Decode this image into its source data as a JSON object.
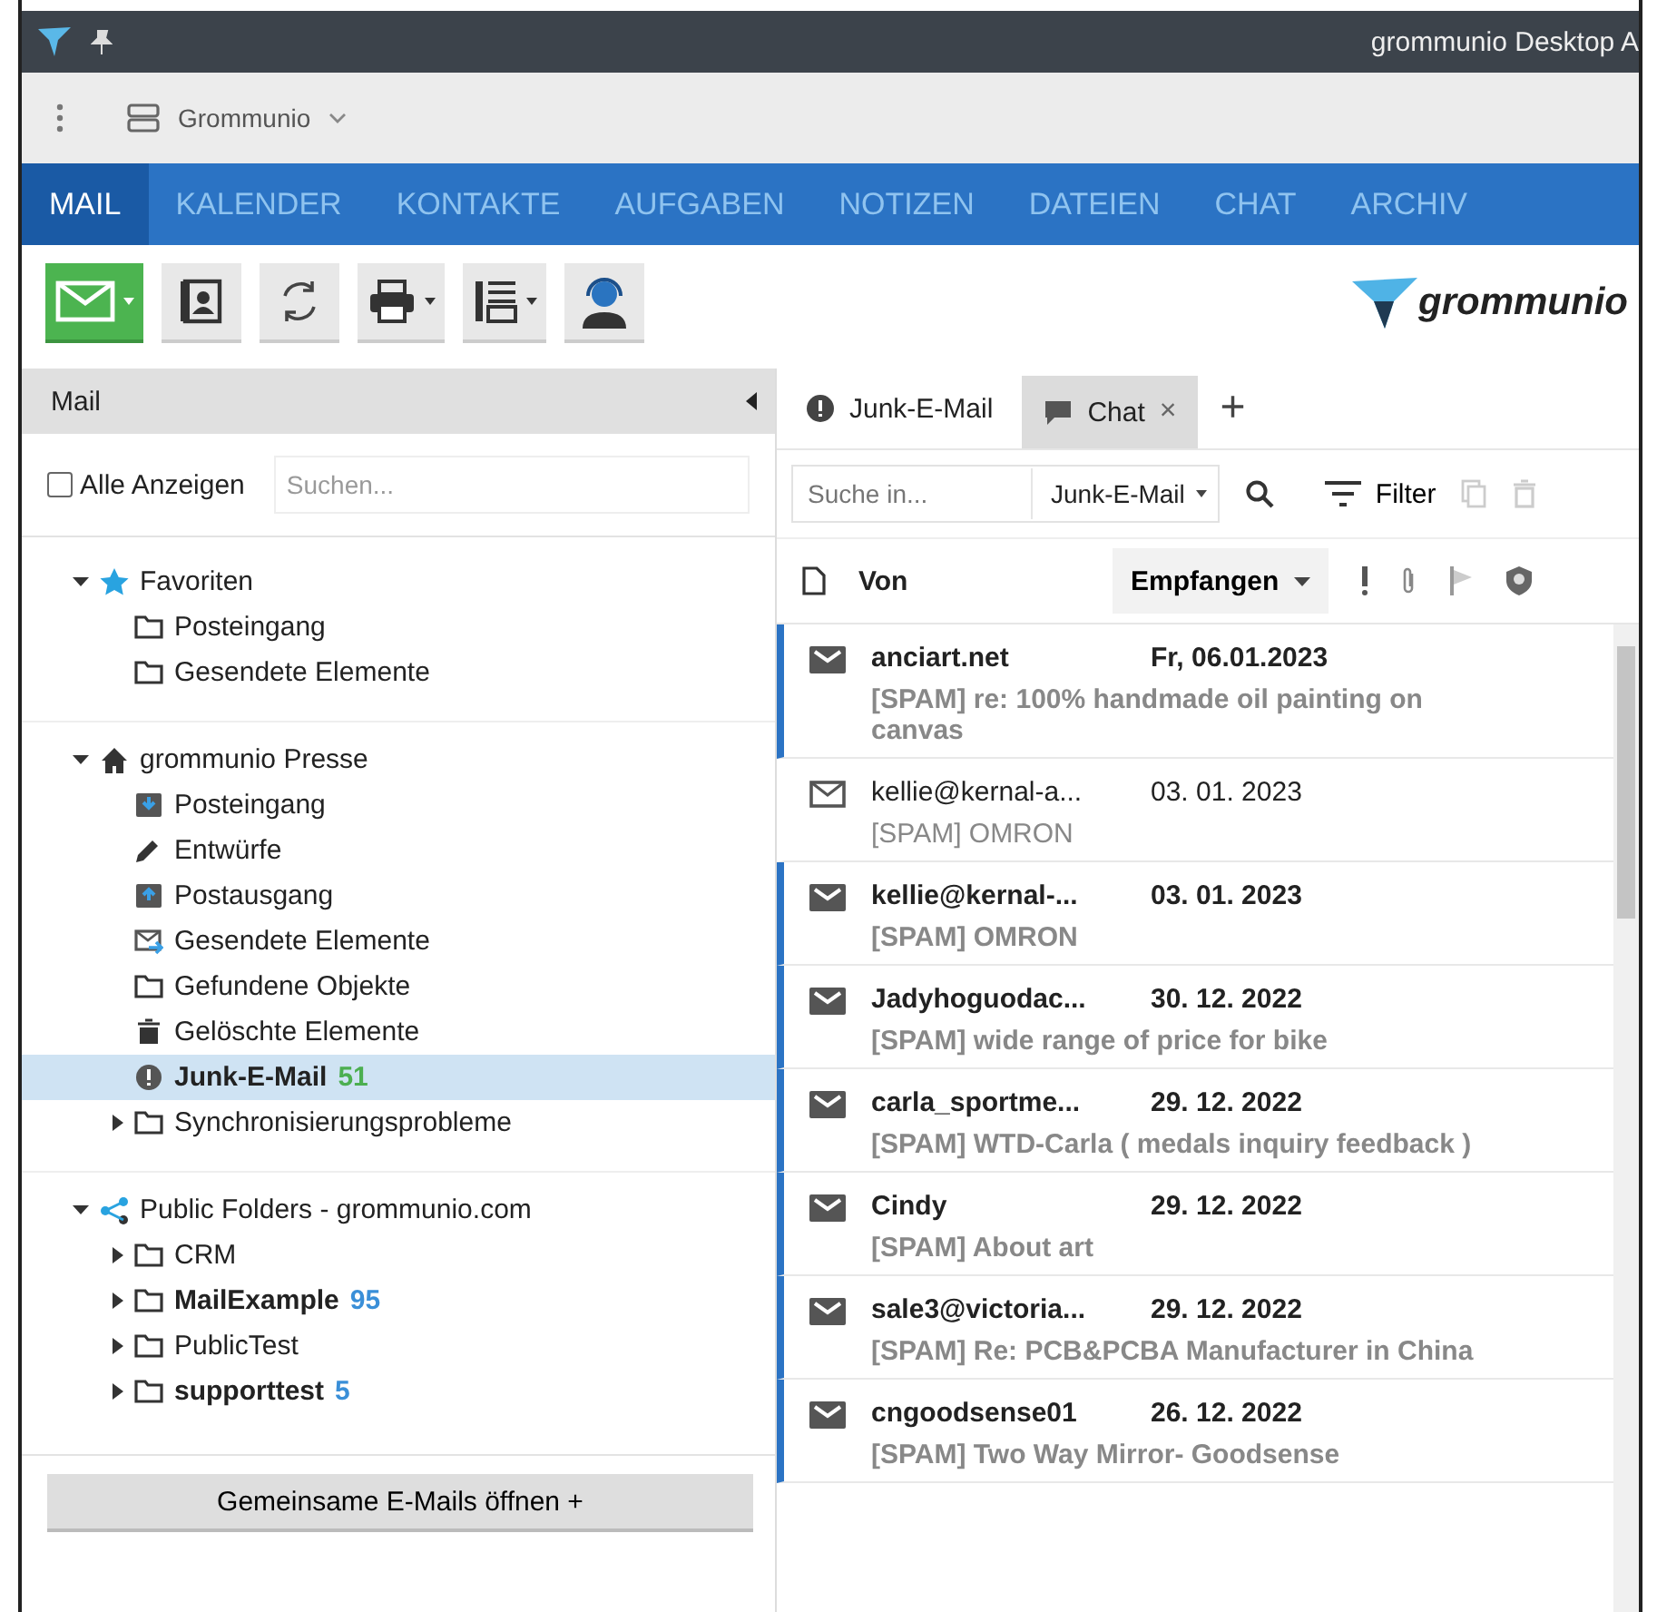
{
  "window": {
    "title": "grommunio Desktop A"
  },
  "app_bar": {
    "account": "Grommunio"
  },
  "nav": [
    {
      "label": "MAIL",
      "selected": true
    },
    {
      "label": "KALENDER",
      "selected": false
    },
    {
      "label": "KONTAKTE",
      "selected": false
    },
    {
      "label": "AUFGABEN",
      "selected": false
    },
    {
      "label": "NOTIZEN",
      "selected": false
    },
    {
      "label": "DATEIEN",
      "selected": false
    },
    {
      "label": "CHAT",
      "selected": false
    },
    {
      "label": "ARCHIV",
      "selected": false
    }
  ],
  "logo": "grommunio",
  "sidebar": {
    "title": "Mail",
    "show_all": {
      "label": "Alle Anzeigen",
      "checked": false
    },
    "search": {
      "placeholder": "Suchen..."
    },
    "groups": [
      {
        "label": "Favoriten",
        "kind": "star",
        "expanded": true,
        "children": [
          {
            "label": "Posteingang",
            "kind": "folder",
            "collapsed": false,
            "selected": false
          },
          {
            "label": "Gesendete Elemente",
            "kind": "folder",
            "collapsed": false,
            "selected": false
          }
        ]
      },
      {
        "label": "grommunio Presse",
        "kind": "home",
        "expanded": true,
        "children": [
          {
            "label": "Posteingang",
            "kind": "inbox",
            "collapsed": false,
            "selected": false
          },
          {
            "label": "Entwürfe",
            "kind": "pencil",
            "collapsed": false,
            "selected": false
          },
          {
            "label": "Postausgang",
            "kind": "outbox",
            "collapsed": false,
            "selected": false
          },
          {
            "label": "Gesendete Elemente",
            "kind": "sent",
            "collapsed": false,
            "selected": false
          },
          {
            "label": "Gefundene Objekte",
            "kind": "folder",
            "collapsed": false,
            "selected": false
          },
          {
            "label": "Gelöschte Elemente",
            "kind": "trash",
            "collapsed": false,
            "selected": false
          },
          {
            "label": "Junk-E-Mail",
            "kind": "junk",
            "collapsed": false,
            "selected": true,
            "count": "51",
            "color": "#4caf50"
          },
          {
            "label": "Synchronisierungsprobleme",
            "kind": "folder",
            "collapsed": true,
            "selected": false
          }
        ]
      },
      {
        "label": "Public Folders - grommunio.com",
        "kind": "share",
        "expanded": true,
        "children": [
          {
            "label": "CRM",
            "kind": "folder",
            "collapsed": true,
            "selected": false
          },
          {
            "label": "MailExample",
            "kind": "folder",
            "collapsed": true,
            "selected": false,
            "count": "95",
            "color": "#3a8fd8"
          },
          {
            "label": "PublicTest",
            "kind": "folder",
            "collapsed": true,
            "selected": false
          },
          {
            "label": "supporttest",
            "kind": "folder",
            "collapsed": true,
            "selected": false,
            "count": "5",
            "color": "#3a8fd8"
          }
        ]
      }
    ],
    "open_shared": "Gemeinsame E-Mails öffnen +"
  },
  "tabs": [
    {
      "label": "Junk-E-Mail",
      "kind": "junk",
      "selected": true
    },
    {
      "label": "Chat",
      "kind": "chat",
      "selected": false,
      "close": "×"
    }
  ],
  "new_tab": "+",
  "search": {
    "placeholder": "Suche in...",
    "scope": "Junk-E-Mail",
    "filter": "Filter"
  },
  "columns": {
    "from": "Von",
    "received": "Empfangen"
  },
  "messages": [
    {
      "from": "anciart.net",
      "date": "Fr, 06.01.2023",
      "subject": "[SPAM] re: 100% handmade oil painting on canvas",
      "unread": true
    },
    {
      "from": "kellie@kernal-a...",
      "date": "03. 01. 2023",
      "subject": "[SPAM] OMRON",
      "unread": false
    },
    {
      "from": "kellie@kernal-...",
      "date": "03. 01. 2023",
      "subject": "[SPAM] OMRON",
      "unread": true
    },
    {
      "from": "Jadyhoguodac...",
      "date": "30. 12. 2022",
      "subject": "[SPAM] wide range of price for bike",
      "unread": true
    },
    {
      "from": "carla_sportme...",
      "date": "29. 12. 2022",
      "subject": "[SPAM] WTD-Carla ( medals inquiry feedback )",
      "unread": true
    },
    {
      "from": "Cindy",
      "date": "29. 12. 2022",
      "subject": "[SPAM] About art",
      "unread": true
    },
    {
      "from": "sale3@victoria...",
      "date": "29. 12. 2022",
      "subject": "[SPAM] Re: PCB&PCBA Manufacturer in China",
      "unread": true
    },
    {
      "from": "cngoodsense01",
      "date": "26. 12. 2022",
      "subject": "[SPAM] Two Way Mirror- Goodsense",
      "unread": true
    }
  ]
}
